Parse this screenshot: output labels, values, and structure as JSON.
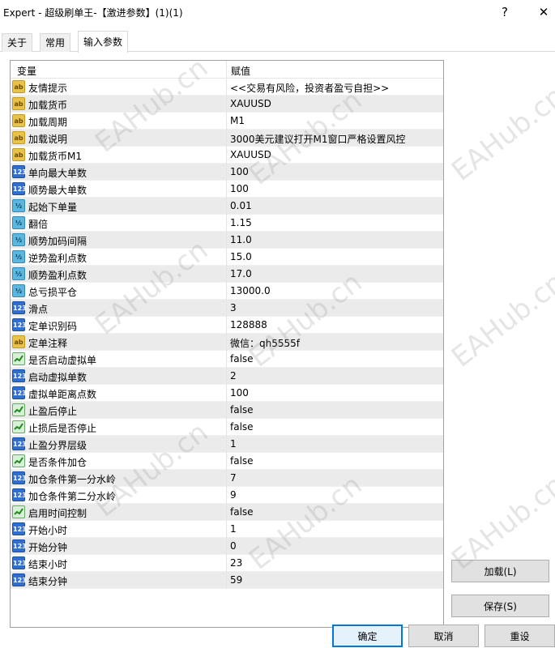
{
  "window": {
    "title": "Expert - 超级刷单王-【激进参数】(1)(1)",
    "help_glyph": "?",
    "close_glyph": "✕"
  },
  "tabs": [
    {
      "label": "关于"
    },
    {
      "label": "常用"
    },
    {
      "label": "输入参数"
    }
  ],
  "grid": {
    "col_variable": "变量",
    "col_value": "赋值",
    "rows": [
      {
        "name": "友情提示",
        "value": "<<交易有风险，投资者盈亏自担>>",
        "type": "ab"
      },
      {
        "name": "加载货币",
        "value": "XAUUSD",
        "type": "ab"
      },
      {
        "name": "加载周期",
        "value": "M1",
        "type": "ab"
      },
      {
        "name": "加载说明",
        "value": "3000美元建议打开M1窗口严格设置风控",
        "type": "ab"
      },
      {
        "name": "加载货币M1",
        "value": "XAUUSD",
        "type": "ab"
      },
      {
        "name": "单向最大单数",
        "value": "100",
        "type": "123"
      },
      {
        "name": "顺势最大单数",
        "value": "100",
        "type": "123"
      },
      {
        "name": "起始下单量",
        "value": "0.01",
        "type": "half"
      },
      {
        "name": "翻倍",
        "value": "1.15",
        "type": "half"
      },
      {
        "name": "顺势加码间隔",
        "value": "11.0",
        "type": "half"
      },
      {
        "name": "逆势盈利点数",
        "value": "15.0",
        "type": "half"
      },
      {
        "name": "顺势盈利点数",
        "value": "17.0",
        "type": "half"
      },
      {
        "name": "总亏损平仓",
        "value": "13000.0",
        "type": "half"
      },
      {
        "name": "滑点",
        "value": "3",
        "type": "123"
      },
      {
        "name": "定单识别码",
        "value": "128888",
        "type": "123"
      },
      {
        "name": "定单注释",
        "value": " 微信：qh5555f",
        "type": "ab"
      },
      {
        "name": "是否启动虚拟单",
        "value": "false",
        "type": "bool"
      },
      {
        "name": "启动虚拟单数",
        "value": "2",
        "type": "123"
      },
      {
        "name": "虚拟单距离点数",
        "value": "100",
        "type": "123"
      },
      {
        "name": "止盈后停止",
        "value": "false",
        "type": "bool"
      },
      {
        "name": "止损后是否停止",
        "value": "false",
        "type": "bool"
      },
      {
        "name": "止盈分界层级",
        "value": "1",
        "type": "123"
      },
      {
        "name": "是否条件加仓",
        "value": "false",
        "type": "bool"
      },
      {
        "name": "加仓条件第一分水岭",
        "value": "7",
        "type": "123"
      },
      {
        "name": "加仓条件第二分水岭",
        "value": "9",
        "type": "123"
      },
      {
        "name": "启用时间控制",
        "value": "false",
        "type": "bool"
      },
      {
        "name": "开始小时",
        "value": "1",
        "type": "123"
      },
      {
        "name": "开始分钟",
        "value": "0",
        "type": "123"
      },
      {
        "name": "结束小时",
        "value": "23",
        "type": "123"
      },
      {
        "name": "结束分钟",
        "value": "59",
        "type": "123"
      }
    ]
  },
  "icons": {
    "ab": "ab",
    "123": "123",
    "half": "½"
  },
  "buttons": {
    "load": "加载(L)",
    "save": "保存(S)",
    "ok": "确定",
    "cancel": "取消",
    "reset": "重设"
  },
  "watermark": {
    "a": "EAHub.cn",
    "b": "EAHub.cn"
  }
}
